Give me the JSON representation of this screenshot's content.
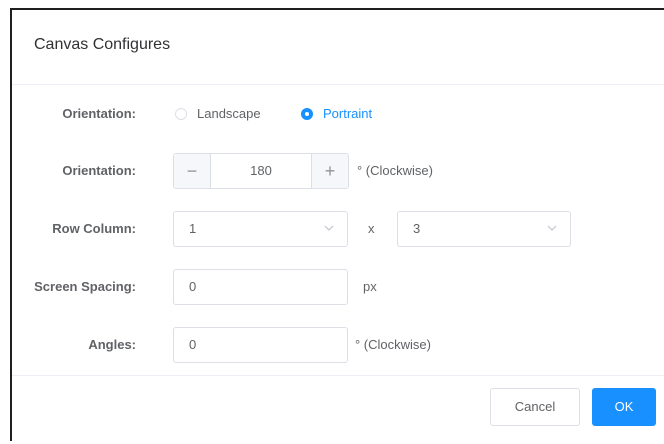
{
  "dialog": {
    "title": "Canvas Configures"
  },
  "orientation": {
    "label": "Orientation:",
    "options": [
      {
        "label": "Landscape",
        "checked": false
      },
      {
        "label": "Portraint",
        "checked": true
      }
    ]
  },
  "rotation": {
    "label": "Orientation:",
    "value": "180",
    "minus_symbol": "−",
    "plus_symbol": "+",
    "unit": "° (Clockwise)"
  },
  "row_column": {
    "label": "Row Column:",
    "rows": "1",
    "separator": "x",
    "columns": "3"
  },
  "screen_spacing": {
    "label": "Screen Spacing:",
    "value": "0",
    "unit": "px"
  },
  "angles": {
    "label": "Angles:",
    "value": "0",
    "unit": "° (Clockwise)"
  },
  "footer": {
    "cancel_label": "Cancel",
    "ok_label": "OK"
  },
  "colors": {
    "primary": "#1890ff",
    "border": "#dcdfe6",
    "text": "#606266"
  },
  "icons": {
    "select_arrow": "chevron-down-icon"
  }
}
